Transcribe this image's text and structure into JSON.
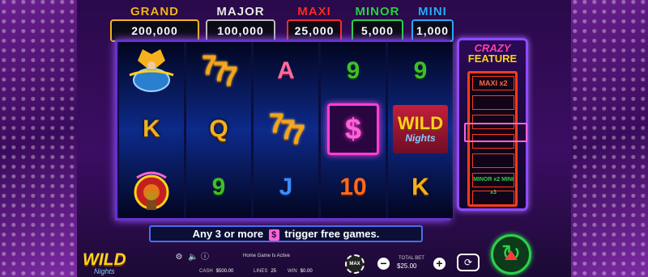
{
  "jackpots": {
    "grand": {
      "label": "GRAND",
      "value": "200,000",
      "color": "#f5b21e"
    },
    "major": {
      "label": "MAJOR",
      "value": "100,000",
      "color": "#e8e8e8"
    },
    "maxi": {
      "label": "MAXI",
      "value": "25,000",
      "color": "#ff2a2a"
    },
    "minor": {
      "label": "MINOR",
      "value": "5,000",
      "color": "#2ad14a"
    },
    "mini": {
      "label": "MINI",
      "value": "1,000",
      "color": "#2aa8ff"
    }
  },
  "reels": [
    [
      "vegas-showgirl-icon",
      "K",
      "vegas-sign-icon"
    ],
    [
      "sevens-icon",
      "Q",
      "9"
    ],
    [
      "A",
      "sevens-icon",
      "J"
    ],
    [
      "9",
      "$",
      "10"
    ],
    [
      "9",
      "WILD",
      "K"
    ]
  ],
  "symbols": {
    "wild_word": "WILD",
    "wild_sub": "Nights",
    "dollar": "$",
    "seven": "7"
  },
  "crazy_feature": {
    "title_line1": "CRAZY",
    "title_line2": "FEATURE",
    "top_slot": "MAXI x2",
    "bottom_slot": "MINOR x2  MINI x3"
  },
  "message": {
    "prefix": "Any 3 or more",
    "icon": "$",
    "suffix": "trigger free games."
  },
  "hud": {
    "logo_word": "WILD",
    "logo_sub": "Nights",
    "notice": "Home Game Is Active",
    "cash_label": "CASH",
    "cash_value": "$500.00",
    "lines_label": "LINES",
    "lines_value": "25",
    "win_label": "WIN",
    "win_value": "$0.00",
    "max_label": "MAX",
    "bet_label": "TOTAL BET",
    "bet_value": "$25.00",
    "bet_minus": "−",
    "bet_plus": "+"
  }
}
